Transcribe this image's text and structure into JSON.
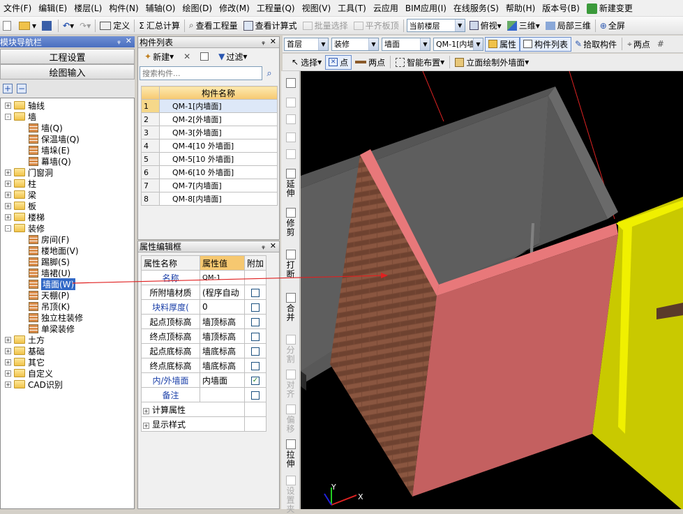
{
  "menu": [
    "文件(F)",
    "编辑(E)",
    "楼层(L)",
    "构件(N)",
    "辅轴(O)",
    "绘图(D)",
    "修改(M)",
    "工程量(Q)",
    "视图(V)",
    "工具(T)",
    "云应用",
    "BIM应用(I)",
    "在线服务(S)",
    "帮助(H)",
    "版本号(B)",
    "新建变更"
  ],
  "toolbar1": {
    "define": "定义",
    "summary": "汇总计算",
    "view_qty": "查看工程量",
    "view_formula": "查看计算式",
    "batch_select": "批量选择",
    "flat_board": "平齐板顶",
    "current_floor": "当前楼层",
    "top_view": "俯视",
    "three_d": "三维",
    "local_3d": "局部三维",
    "fullscreen": "全屏"
  },
  "toolbar2": {
    "floor": "首层",
    "category": "装修",
    "type": "墙面",
    "component": "QM-1[内墙",
    "attr": "属性",
    "comp_list": "构件列表",
    "pick": "拾取构件",
    "two_points": "两点"
  },
  "toolbar3": {
    "select": "选择",
    "point": "点",
    "two_points": "两点",
    "smart_place": "智能布置",
    "facade": "立面绘制外墙面"
  },
  "nav": {
    "title": "模块导航栏",
    "project_settings": "工程设置",
    "drawing_input": "绘图输入"
  },
  "tree": [
    {
      "label": "轴线",
      "exp": "+",
      "kind": "folder",
      "lvl": 0
    },
    {
      "label": "墙",
      "exp": "-",
      "kind": "folder",
      "lvl": 0
    },
    {
      "label": "墙(Q)",
      "kind": "leaf",
      "lvl": 1
    },
    {
      "label": "保温墙(Q)",
      "kind": "leaf",
      "lvl": 1
    },
    {
      "label": "墙垛(E)",
      "kind": "leaf",
      "lvl": 1
    },
    {
      "label": "幕墙(Q)",
      "kind": "leaf",
      "lvl": 1
    },
    {
      "label": "门窗洞",
      "exp": "+",
      "kind": "folder",
      "lvl": 0
    },
    {
      "label": "柱",
      "exp": "+",
      "kind": "folder",
      "lvl": 0
    },
    {
      "label": "梁",
      "exp": "+",
      "kind": "folder",
      "lvl": 0
    },
    {
      "label": "板",
      "exp": "+",
      "kind": "folder",
      "lvl": 0
    },
    {
      "label": "楼梯",
      "exp": "+",
      "kind": "folder",
      "lvl": 0
    },
    {
      "label": "装修",
      "exp": "-",
      "kind": "folder",
      "lvl": 0
    },
    {
      "label": "房间(F)",
      "kind": "leaf",
      "lvl": 1
    },
    {
      "label": "楼地面(V)",
      "kind": "leaf",
      "lvl": 1
    },
    {
      "label": "踢脚(S)",
      "kind": "leaf",
      "lvl": 1
    },
    {
      "label": "墙裙(U)",
      "kind": "leaf",
      "lvl": 1
    },
    {
      "label": "墙面(W)",
      "kind": "leaf",
      "lvl": 1,
      "selected": true
    },
    {
      "label": "天棚(P)",
      "kind": "leaf",
      "lvl": 1
    },
    {
      "label": "吊顶(K)",
      "kind": "leaf",
      "lvl": 1
    },
    {
      "label": "独立柱装修",
      "kind": "leaf",
      "lvl": 1
    },
    {
      "label": "单梁装修",
      "kind": "leaf",
      "lvl": 1
    },
    {
      "label": "土方",
      "exp": "+",
      "kind": "folder",
      "lvl": 0
    },
    {
      "label": "基础",
      "exp": "+",
      "kind": "folder",
      "lvl": 0
    },
    {
      "label": "其它",
      "exp": "+",
      "kind": "folder",
      "lvl": 0
    },
    {
      "label": "自定义",
      "exp": "+",
      "kind": "folder",
      "lvl": 0
    },
    {
      "label": "CAD识别",
      "exp": "+",
      "kind": "folder",
      "lvl": 0
    }
  ],
  "complist": {
    "title": "构件列表",
    "new": "新建",
    "filter": "过滤",
    "search_placeholder": "搜索构件...",
    "header": "构件名称",
    "rows": [
      {
        "n": "1",
        "name": "QM-1[内墙面]"
      },
      {
        "n": "2",
        "name": "QM-2[外墙面]"
      },
      {
        "n": "3",
        "name": "QM-3[外墙面]"
      },
      {
        "n": "4",
        "name": "QM-4[10 外墙面]"
      },
      {
        "n": "5",
        "name": "QM-5[10 外墙面]"
      },
      {
        "n": "6",
        "name": "QM-6[10 外墙面]"
      },
      {
        "n": "7",
        "name": "QM-7[内墙面]"
      },
      {
        "n": "8",
        "name": "QM-8[内墙面]"
      }
    ]
  },
  "props": {
    "title": "属性编辑框",
    "h_name": "属性名称",
    "h_val": "属性值",
    "h_add": "附加",
    "rows": [
      {
        "name": "名称",
        "val": "QM-1",
        "blue": true,
        "chk": null
      },
      {
        "name": "所附墙材质",
        "val": "(程序自动",
        "blue": false,
        "chk": false
      },
      {
        "name": "块料厚度(",
        "val": "0",
        "blue": true,
        "chk": false
      },
      {
        "name": "起点顶标高",
        "val": "墙顶标高",
        "blue": false,
        "chk": false
      },
      {
        "name": "终点顶标高",
        "val": "墙顶标高",
        "blue": false,
        "chk": false
      },
      {
        "name": "起点底标高",
        "val": "墙底标高",
        "blue": false,
        "chk": false
      },
      {
        "name": "终点底标高",
        "val": "墙底标高",
        "blue": false,
        "chk": false
      },
      {
        "name": "内/外墙面",
        "val": "内墙面",
        "blue": true,
        "chk": true
      },
      {
        "name": "备注",
        "val": "",
        "blue": true,
        "chk": false
      },
      {
        "name": "计算属性",
        "val": "",
        "blue": false,
        "chk": null,
        "group": true
      },
      {
        "name": "显示样式",
        "val": "",
        "blue": false,
        "chk": null,
        "group": true
      }
    ]
  },
  "vtools": [
    {
      "label": "",
      "dis": false
    },
    {
      "label": "",
      "dis": true
    },
    {
      "label": "",
      "dis": true
    },
    {
      "label": "",
      "dis": true
    },
    {
      "label": "",
      "dis": true
    },
    {
      "label": "延伸",
      "dis": false
    },
    {
      "label": "修剪",
      "dis": false
    },
    {
      "label": "打断",
      "dis": false
    },
    {
      "label": "合并",
      "dis": false
    },
    {
      "label": "分割",
      "dis": true
    },
    {
      "label": "对齐",
      "dis": true
    },
    {
      "label": "偏移",
      "dis": true
    },
    {
      "label": "拉伸",
      "dis": false
    },
    {
      "label": "设置夹",
      "dis": true
    }
  ],
  "axis": {
    "y": "Y",
    "x": "X"
  },
  "colors": {
    "pink": "#e8787a",
    "yellow": "#d6d600",
    "brick": "#7a4a36",
    "grey": "#5a5a5a"
  }
}
